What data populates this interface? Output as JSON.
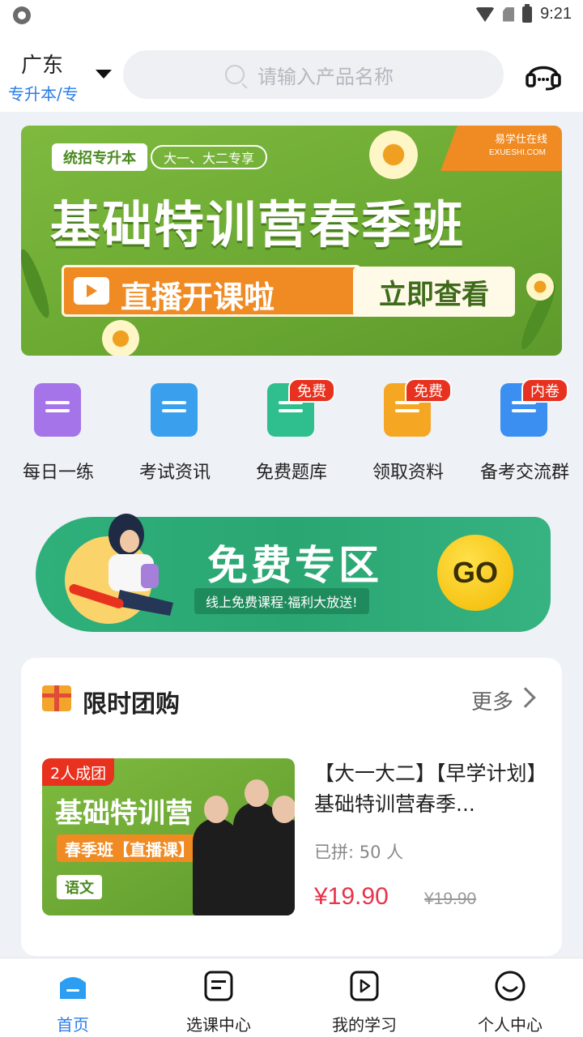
{
  "status_bar": {
    "time": "9:21"
  },
  "header": {
    "location": "广东",
    "category": "专升本/专",
    "search_placeholder": "请输入产品名称"
  },
  "banner": {
    "tag": "统招专升本",
    "tag2": "大一、大二专享",
    "logo_name": "易学仕在线",
    "logo_url": "EXUESHI.COM",
    "title": "基础特训营春季班",
    "live_text": "直播开课啦",
    "cta": "立即查看"
  },
  "quick_links": [
    {
      "label": "每日一练",
      "badge": "",
      "color": "#a574e8"
    },
    {
      "label": "考试资讯",
      "badge": "",
      "color": "#3aa0ee"
    },
    {
      "label": "免费题库",
      "badge": "免费",
      "color": "#2fbf8f"
    },
    {
      "label": "领取资料",
      "badge": "免费",
      "color": "#f5a623"
    },
    {
      "label": "备考交流群",
      "badge": "内卷",
      "color": "#3b8ff0"
    }
  ],
  "free_zone": {
    "title": "免费专区",
    "subtitle": "线上免费课程·福利大放送!",
    "go": "GO"
  },
  "group_buy": {
    "title": "限时团购",
    "more": "更多",
    "product": {
      "badge": "2人成团",
      "img_title": "基础特训营",
      "img_sub": "春季班【直播课】",
      "img_tag": "语文",
      "name": "【大一大二】【早学计划】基础特训营春季...",
      "joined": "已拼: 50 人",
      "price": "¥19.90",
      "old_price": "¥19.90"
    }
  },
  "tabs": [
    {
      "label": "首页",
      "active": true
    },
    {
      "label": "选课中心",
      "active": false
    },
    {
      "label": "我的学习",
      "active": false
    },
    {
      "label": "个人中心",
      "active": false
    }
  ],
  "colors": {
    "accent": "#2b7de9",
    "price": "#e8334a",
    "badge": "#e8321f",
    "banner_green": "#6aa832"
  }
}
